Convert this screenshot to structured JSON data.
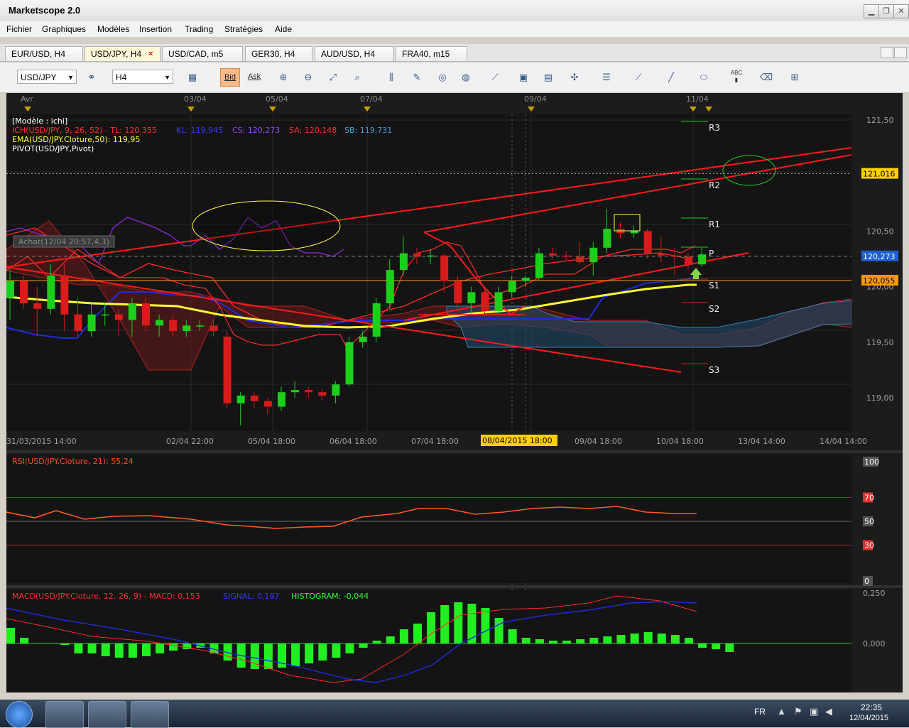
{
  "window": {
    "title": "Marketscope 2.0",
    "min": "▁",
    "max": "❐",
    "close": "✕"
  },
  "menu": [
    "Fichier",
    "Graphiques",
    "Modèles",
    "Insertion",
    "Trading",
    "Stratégies",
    "Aide"
  ],
  "tabs": [
    {
      "label": "EUR/USD, H4"
    },
    {
      "label": "USD/JPY, H4",
      "active": true,
      "close": "✕"
    },
    {
      "label": "USD/CAD, m5"
    },
    {
      "label": "GER30, H4"
    },
    {
      "label": "AUD/USD, H4"
    },
    {
      "label": "FRA40, m15"
    }
  ],
  "toolbar": {
    "symbol": "USD/JPY",
    "timeframe": "H4",
    "bid_label": "Bid",
    "ask_label": "Ask",
    "abc": "ABC"
  },
  "chart": {
    "date_top_labels": [
      "Avr",
      "03/04",
      "05/04",
      "07/04",
      "09/04",
      "11/04"
    ],
    "legend": {
      "model": "[Modèle : ichi]",
      "ichi_prefix": "ICH(USD/JPY, 9, 26, 52) -  TL: 120,355",
      "ichi_kl": "KL: 119,945",
      "ichi_cs": "CS: 120,273",
      "ichi_sa": "SA: 120,148",
      "ichi_sb": "SB: 119,731",
      "ema": "EMA(USD/JPY.Cloture,50): 119,95",
      "pivot": "PIVOT(USD/JPY,Pivot)"
    },
    "order_label": "Achat(12/04 20:57,4,3)",
    "pivot_labels": [
      "R3",
      "R2",
      "R1",
      "P",
      "S1",
      "S2",
      "S3"
    ],
    "price_axis": [
      "121,50",
      "121,00",
      "120,50",
      "120,00",
      "119,50",
      "119,00"
    ],
    "price_flags": {
      "line1": "121,016",
      "current": "120,273",
      "line2": "120,055"
    },
    "x_axis": [
      "31/03/2015 14:00",
      "02/04 22:00",
      "05/04 18:00",
      "06/04 18:00",
      "07/04 18:00",
      "08/04/2015 18:00",
      "09/04 18:00",
      "10/04 18:00",
      "13/04 14:00",
      "14/04 14:00"
    ]
  },
  "rsi": {
    "label": "RSI(USD/JPY.Cloture, 21): 55,24",
    "axis": [
      "100",
      "70",
      "50",
      "30",
      "0"
    ]
  },
  "macd": {
    "label_main": "MACD(USD/JPY.Cloture, 12, 26, 9) -  MACD: 0,153",
    "label_signal": "SIGNAL: 0,197",
    "label_hist": "HISTOGRAM: -0,044",
    "axis": [
      "0,250",
      "0,000"
    ]
  },
  "chart_data": {
    "type": "candlestick",
    "title": "USD/JPY, H4",
    "candles": [
      {
        "o": 119.9,
        "h": 120.15,
        "l": 119.7,
        "c": 120.05
      },
      {
        "o": 120.05,
        "h": 120.1,
        "l": 119.8,
        "c": 119.85
      },
      {
        "o": 119.85,
        "h": 120.0,
        "l": 119.55,
        "c": 119.8
      },
      {
        "o": 119.8,
        "h": 120.2,
        "l": 119.75,
        "c": 120.1
      },
      {
        "o": 120.1,
        "h": 120.2,
        "l": 119.6,
        "c": 119.75
      },
      {
        "o": 119.75,
        "h": 119.9,
        "l": 119.55,
        "c": 119.6
      },
      {
        "o": 119.6,
        "h": 119.85,
        "l": 119.55,
        "c": 119.75
      },
      {
        "o": 119.75,
        "h": 119.85,
        "l": 119.65,
        "c": 119.75
      },
      {
        "o": 119.75,
        "h": 119.8,
        "l": 119.55,
        "c": 119.7
      },
      {
        "o": 119.7,
        "h": 119.9,
        "l": 119.55,
        "c": 119.85
      },
      {
        "o": 119.85,
        "h": 119.9,
        "l": 119.6,
        "c": 119.65
      },
      {
        "o": 119.65,
        "h": 119.75,
        "l": 119.55,
        "c": 119.7
      },
      {
        "o": 119.7,
        "h": 119.75,
        "l": 119.55,
        "c": 119.6
      },
      {
        "o": 119.6,
        "h": 119.7,
        "l": 119.55,
        "c": 119.65
      },
      {
        "o": 119.65,
        "h": 119.7,
        "l": 119.6,
        "c": 119.65
      },
      {
        "o": 119.65,
        "h": 119.7,
        "l": 119.55,
        "c": 119.6
      },
      {
        "o": 119.55,
        "h": 119.6,
        "l": 118.9,
        "c": 118.95
      },
      {
        "o": 118.95,
        "h": 119.05,
        "l": 118.75,
        "c": 119.02
      },
      {
        "o": 119.02,
        "h": 119.05,
        "l": 118.9,
        "c": 118.97
      },
      {
        "o": 118.97,
        "h": 119.0,
        "l": 118.85,
        "c": 118.92
      },
      {
        "o": 118.92,
        "h": 119.1,
        "l": 118.88,
        "c": 119.05
      },
      {
        "o": 119.05,
        "h": 119.15,
        "l": 119.0,
        "c": 119.07
      },
      {
        "o": 119.07,
        "h": 119.1,
        "l": 119.0,
        "c": 119.05
      },
      {
        "o": 119.05,
        "h": 119.08,
        "l": 118.98,
        "c": 119.02
      },
      {
        "o": 119.02,
        "h": 119.15,
        "l": 118.95,
        "c": 119.12
      },
      {
        "o": 119.12,
        "h": 119.55,
        "l": 119.1,
        "c": 119.5
      },
      {
        "o": 119.5,
        "h": 119.6,
        "l": 119.45,
        "c": 119.55
      },
      {
        "o": 119.55,
        "h": 119.9,
        "l": 119.5,
        "c": 119.85
      },
      {
        "o": 119.85,
        "h": 120.25,
        "l": 119.8,
        "c": 120.15
      },
      {
        "o": 120.15,
        "h": 120.45,
        "l": 120.1,
        "c": 120.3
      },
      {
        "o": 120.3,
        "h": 120.35,
        "l": 120.2,
        "c": 120.27
      },
      {
        "o": 120.27,
        "h": 120.33,
        "l": 120.2,
        "c": 120.28
      },
      {
        "o": 120.28,
        "h": 120.3,
        "l": 119.95,
        "c": 120.05
      },
      {
        "o": 120.05,
        "h": 120.1,
        "l": 119.8,
        "c": 119.85
      },
      {
        "o": 119.85,
        "h": 120.0,
        "l": 119.75,
        "c": 119.95
      },
      {
        "o": 119.95,
        "h": 120.0,
        "l": 119.75,
        "c": 119.78
      },
      {
        "o": 119.78,
        "h": 120.0,
        "l": 119.75,
        "c": 119.95
      },
      {
        "o": 119.95,
        "h": 120.1,
        "l": 119.9,
        "c": 120.05
      },
      {
        "o": 120.05,
        "h": 120.1,
        "l": 120.0,
        "c": 120.08
      },
      {
        "o": 120.08,
        "h": 120.35,
        "l": 120.05,
        "c": 120.3
      },
      {
        "o": 120.3,
        "h": 120.35,
        "l": 120.25,
        "c": 120.28
      },
      {
        "o": 120.28,
        "h": 120.32,
        "l": 120.24,
        "c": 120.27
      },
      {
        "o": 120.27,
        "h": 120.4,
        "l": 120.2,
        "c": 120.22
      },
      {
        "o": 120.22,
        "h": 120.4,
        "l": 120.1,
        "c": 120.35
      },
      {
        "o": 120.35,
        "h": 120.7,
        "l": 120.3,
        "c": 120.52
      },
      {
        "o": 120.52,
        "h": 120.58,
        "l": 120.44,
        "c": 120.48
      },
      {
        "o": 120.48,
        "h": 120.55,
        "l": 120.44,
        "c": 120.5
      },
      {
        "o": 120.5,
        "h": 120.52,
        "l": 120.25,
        "c": 120.3
      },
      {
        "o": 120.3,
        "h": 120.45,
        "l": 120.22,
        "c": 120.28
      },
      {
        "o": 120.28,
        "h": 120.35,
        "l": 120.1,
        "c": 120.27
      },
      {
        "o": 120.27,
        "h": 120.3,
        "l": 120.15,
        "c": 120.2
      },
      {
        "o": 120.2,
        "h": 120.35,
        "l": 120.18,
        "c": 120.29
      }
    ],
    "x_first": "31/03/2015 14:00",
    "ylim": [
      118.7,
      121.55
    ],
    "pivots": {
      "R3": 121.43,
      "R2": 120.84,
      "R1": 120.51,
      "P": 120.27,
      "S1": 119.96,
      "S2": 119.73,
      "S3": 119.16
    },
    "current_price": 120.273,
    "rsi_last": 55.24,
    "macd_last": {
      "macd": 0.153,
      "signal": 0.197,
      "histogram": -0.044
    }
  },
  "taskbar": {
    "lang": "FR",
    "time": "22:35",
    "date": "12/04/2015"
  }
}
